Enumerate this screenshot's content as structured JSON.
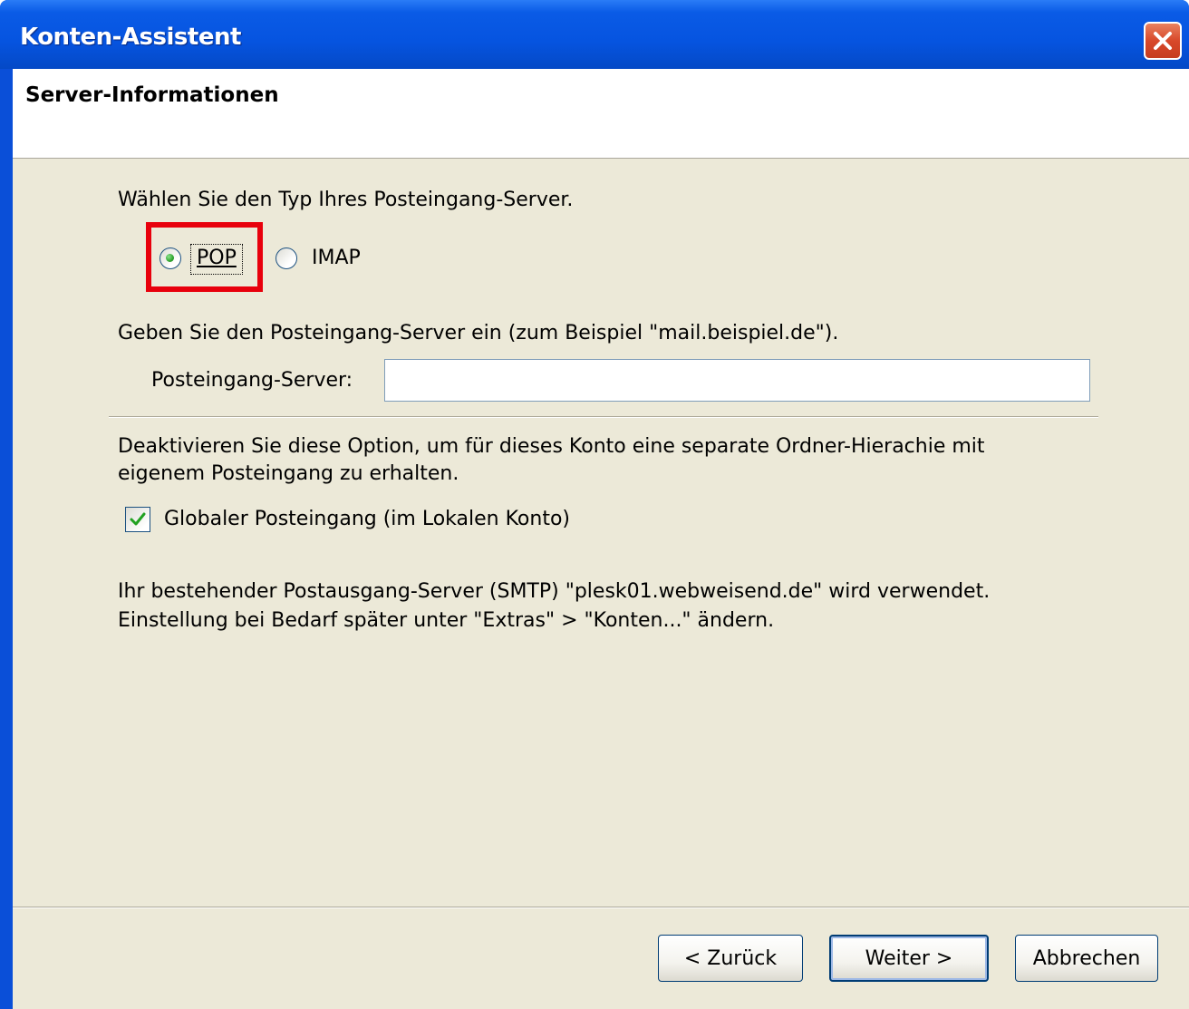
{
  "window": {
    "title": "Konten-Assistent"
  },
  "header": {
    "title": "Server-Informationen"
  },
  "server_type": {
    "prompt": "Wählen Sie den Typ Ihres Posteingang-Server.",
    "options": [
      {
        "label": "POP",
        "selected": true
      },
      {
        "label": "IMAP",
        "selected": false
      }
    ]
  },
  "incoming": {
    "prompt": "Geben Sie den Posteingang-Server ein (zum Beispiel \"mail.beispiel.de\").",
    "field_label": "Posteingang-Server:",
    "value": ""
  },
  "global_inbox": {
    "description_line1": "Deaktivieren Sie diese Option, um für dieses Konto eine separate Ordner-Hierachie mit",
    "description_line2": "eigenem Posteingang zu erhalten.",
    "checkbox_label": "Globaler Posteingang (im Lokalen Konto)",
    "checked": true
  },
  "smtp_info": {
    "line1": "Ihr bestehender Postausgang-Server (SMTP) \"plesk01.webweisend.de\" wird verwendet.",
    "line2": "Einstellung bei Bedarf später unter \"Extras\" > \"Konten...\" ändern."
  },
  "buttons": {
    "back": "< Zurück",
    "next": "Weiter >",
    "cancel": "Abbrechen"
  },
  "colors": {
    "titlebar": "#0654e0",
    "dialog_bg": "#ece9d8",
    "highlight": "#e8000c",
    "radio_selected": "#2ea52e"
  },
  "icons": {
    "close": "close-x-icon",
    "checkmark": "checkmark-icon"
  }
}
